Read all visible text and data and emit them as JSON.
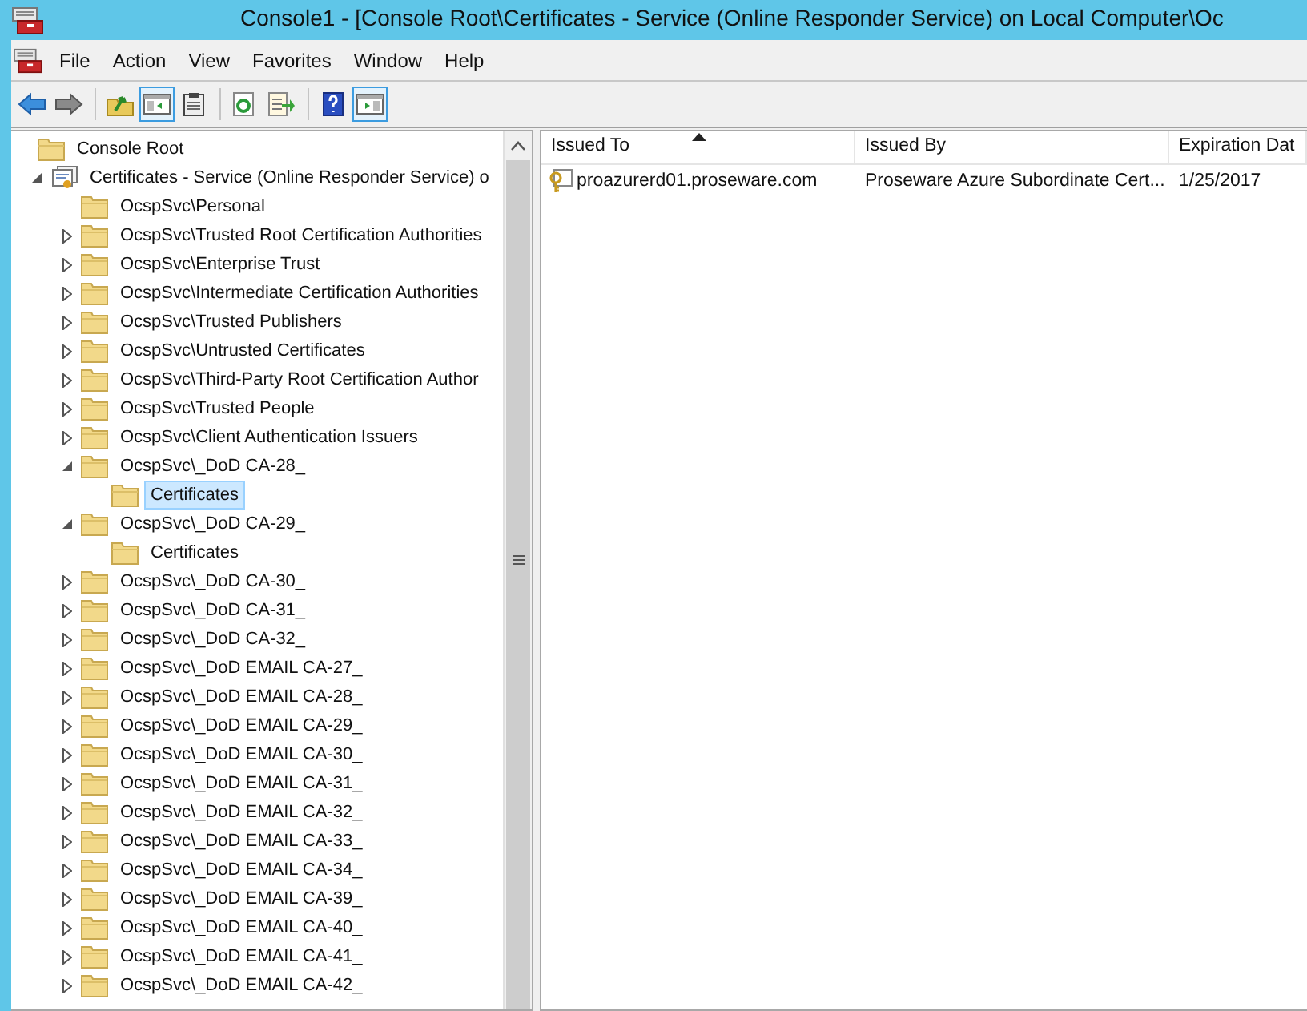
{
  "window": {
    "title": "Console1 - [Console Root\\Certificates - Service (Online Responder Service) on Local Computer\\Oc"
  },
  "menu": [
    "File",
    "Action",
    "View",
    "Favorites",
    "Window",
    "Help"
  ],
  "toolbar": [
    {
      "kind": "back",
      "on": false
    },
    {
      "kind": "forward",
      "on": false
    },
    {
      "kind": "sep"
    },
    {
      "kind": "up",
      "on": false
    },
    {
      "kind": "tree",
      "on": true
    },
    {
      "kind": "clipboard",
      "on": false
    },
    {
      "kind": "sep"
    },
    {
      "kind": "refresh",
      "on": false
    },
    {
      "kind": "export",
      "on": false
    },
    {
      "kind": "sep"
    },
    {
      "kind": "help",
      "on": false
    },
    {
      "kind": "actions",
      "on": true
    }
  ],
  "tree": [
    {
      "label": "Console Root",
      "kind": "folder",
      "selected": false,
      "children": [
        {
          "label": "Certificates - Service (Online Responder Service) o",
          "kind": "cert",
          "expanded": true,
          "selected": false,
          "children": [
            {
              "label": "OcspSvc\\Personal",
              "kind": "folder",
              "selected": false
            },
            {
              "label": "OcspSvc\\Trusted Root Certification Authorities",
              "kind": "folder",
              "expanded": false,
              "selected": false
            },
            {
              "label": "OcspSvc\\Enterprise Trust",
              "kind": "folder",
              "expanded": false,
              "selected": false
            },
            {
              "label": "OcspSvc\\Intermediate Certification Authorities",
              "kind": "folder",
              "expanded": false,
              "selected": false
            },
            {
              "label": "OcspSvc\\Trusted Publishers",
              "kind": "folder",
              "expanded": false,
              "selected": false
            },
            {
              "label": "OcspSvc\\Untrusted Certificates",
              "kind": "folder",
              "expanded": false,
              "selected": false
            },
            {
              "label": "OcspSvc\\Third-Party Root Certification Author",
              "kind": "folder",
              "expanded": false,
              "selected": false
            },
            {
              "label": "OcspSvc\\Trusted People",
              "kind": "folder",
              "expanded": false,
              "selected": false
            },
            {
              "label": "OcspSvc\\Client Authentication Issuers",
              "kind": "folder",
              "expanded": false,
              "selected": false
            },
            {
              "label": "OcspSvc\\_DoD CA-28_",
              "kind": "folder",
              "expanded": true,
              "selected": false,
              "children": [
                {
                  "label": "Certificates",
                  "kind": "folder",
                  "selected": true
                }
              ]
            },
            {
              "label": "OcspSvc\\_DoD CA-29_",
              "kind": "folder",
              "expanded": true,
              "selected": false,
              "children": [
                {
                  "label": "Certificates",
                  "kind": "folder",
                  "selected": false
                }
              ]
            },
            {
              "label": "OcspSvc\\_DoD CA-30_",
              "kind": "folder",
              "expanded": false,
              "selected": false
            },
            {
              "label": "OcspSvc\\_DoD CA-31_",
              "kind": "folder",
              "expanded": false,
              "selected": false
            },
            {
              "label": "OcspSvc\\_DoD CA-32_",
              "kind": "folder",
              "expanded": false,
              "selected": false
            },
            {
              "label": "OcspSvc\\_DoD EMAIL CA-27_",
              "kind": "folder",
              "expanded": false,
              "selected": false
            },
            {
              "label": "OcspSvc\\_DoD EMAIL CA-28_",
              "kind": "folder",
              "expanded": false,
              "selected": false
            },
            {
              "label": "OcspSvc\\_DoD EMAIL CA-29_",
              "kind": "folder",
              "expanded": false,
              "selected": false
            },
            {
              "label": "OcspSvc\\_DoD EMAIL CA-30_",
              "kind": "folder",
              "expanded": false,
              "selected": false
            },
            {
              "label": "OcspSvc\\_DoD EMAIL CA-31_",
              "kind": "folder",
              "expanded": false,
              "selected": false
            },
            {
              "label": "OcspSvc\\_DoD EMAIL CA-32_",
              "kind": "folder",
              "expanded": false,
              "selected": false
            },
            {
              "label": "OcspSvc\\_DoD EMAIL CA-33_",
              "kind": "folder",
              "expanded": false,
              "selected": false
            },
            {
              "label": "OcspSvc\\_DoD EMAIL CA-34_",
              "kind": "folder",
              "expanded": false,
              "selected": false
            },
            {
              "label": "OcspSvc\\_DoD EMAIL CA-39_",
              "kind": "folder",
              "expanded": false,
              "selected": false
            },
            {
              "label": "OcspSvc\\_DoD EMAIL CA-40_",
              "kind": "folder",
              "expanded": false,
              "selected": false
            },
            {
              "label": "OcspSvc\\_DoD EMAIL CA-41_",
              "kind": "folder",
              "expanded": false,
              "selected": false
            },
            {
              "label": "OcspSvc\\_DoD EMAIL CA-42_",
              "kind": "folder",
              "expanded": false,
              "selected": false
            }
          ]
        }
      ]
    }
  ],
  "table": {
    "columns": [
      "Issued To",
      "Issued By",
      "Expiration Dat"
    ],
    "rows": [
      [
        "proazurerd01.proseware.com",
        "Proseware Azure Subordinate Cert...",
        "1/25/2017"
      ]
    ]
  }
}
